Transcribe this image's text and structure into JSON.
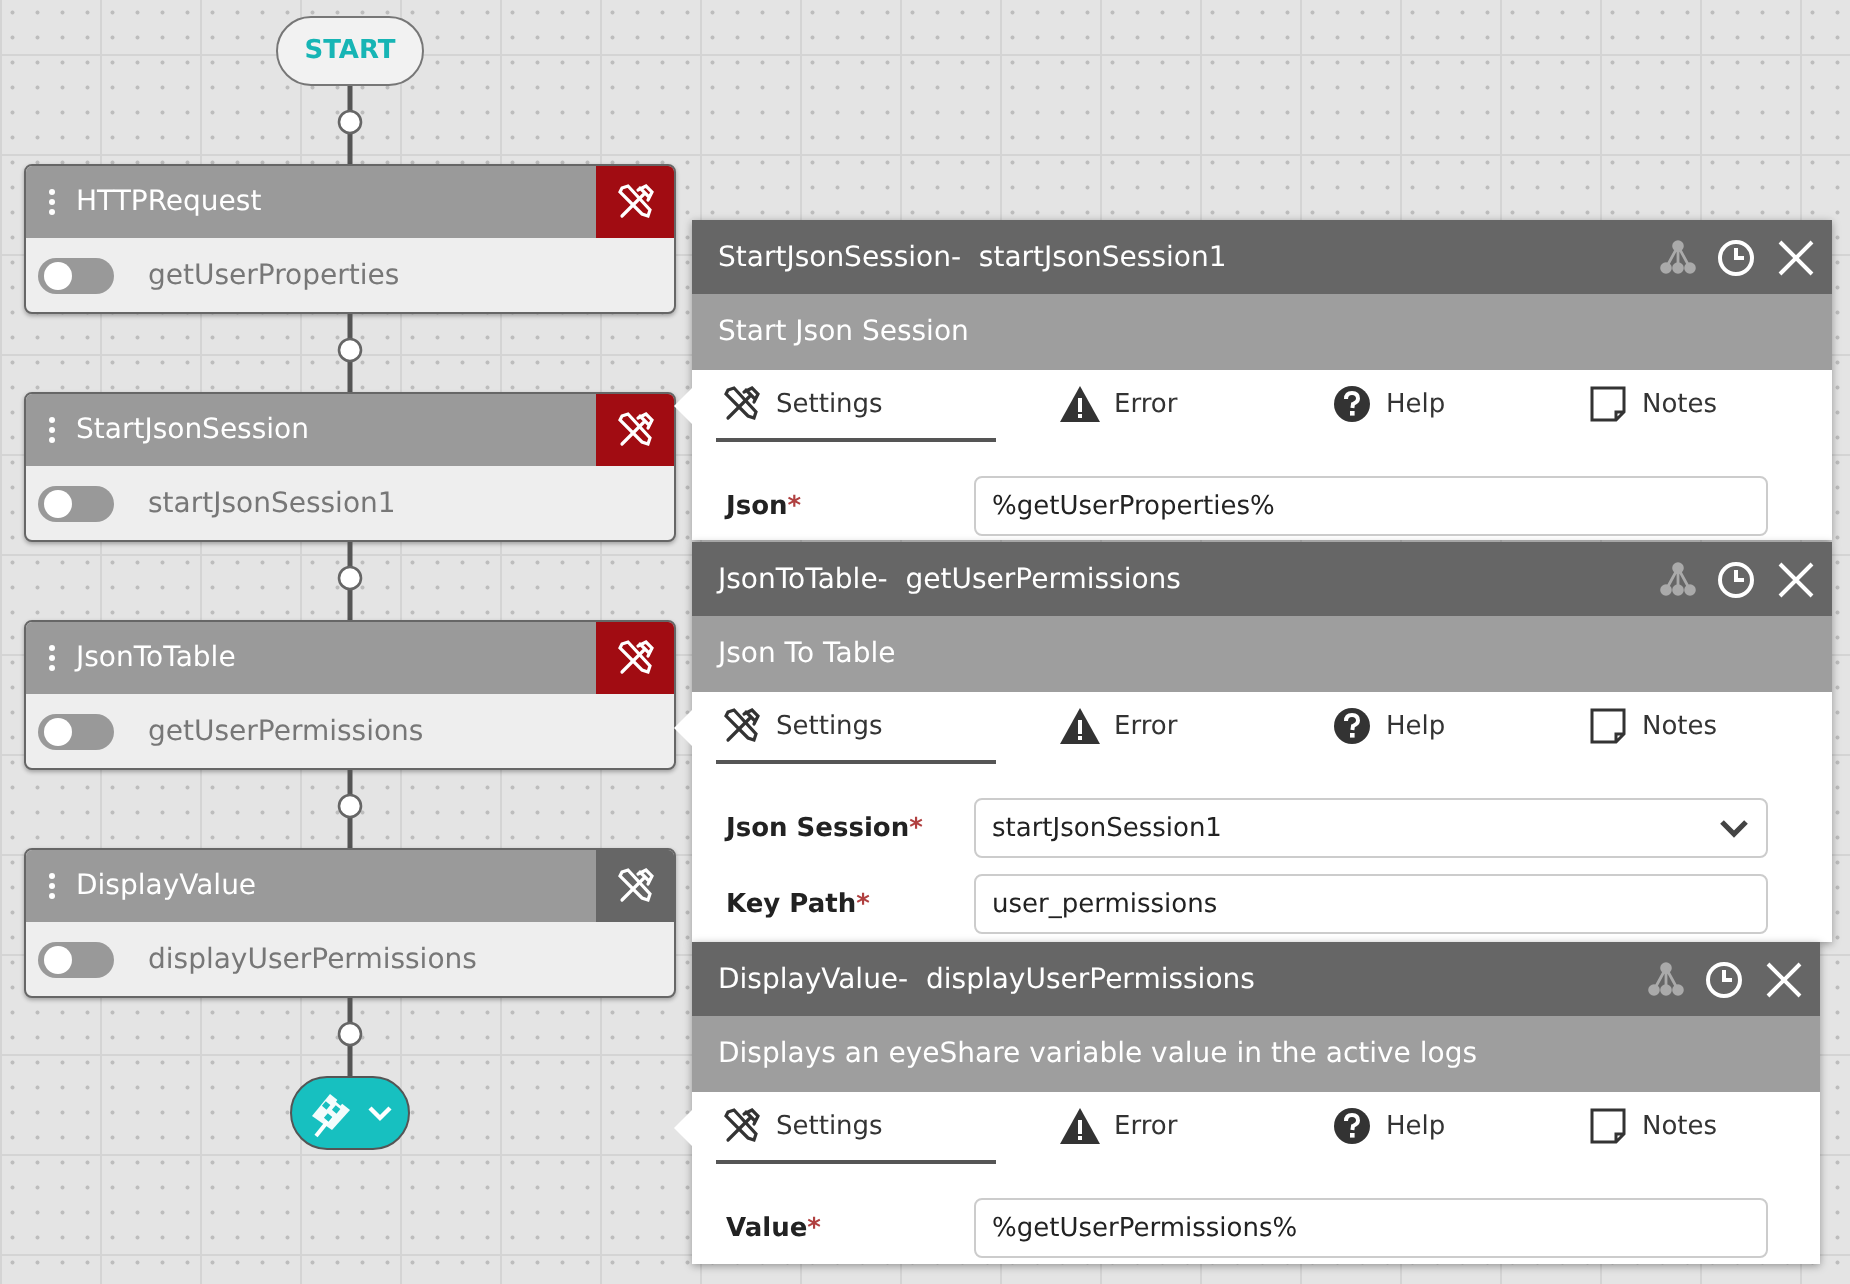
{
  "start": {
    "label": "START"
  },
  "nodes": [
    {
      "type": "HTTPRequest",
      "name": "getUserProperties",
      "on": false,
      "error": true
    },
    {
      "type": "StartJsonSession",
      "name": "startJsonSession1",
      "on": false,
      "error": true
    },
    {
      "type": "JsonToTable",
      "name": "getUserPermissions",
      "on": false,
      "error": true
    },
    {
      "type": "DisplayValue",
      "name": "displayUserPermissions",
      "on": false,
      "error": false
    }
  ],
  "end": {
    "expanded": false
  },
  "panels": [
    {
      "title": "StartJsonSession-  startJsonSession1",
      "subtitle": "Start Json Session",
      "tabs": [
        {
          "label": "Settings",
          "kind": "settings",
          "selected": true
        },
        {
          "label": "Error",
          "kind": "error",
          "selected": false
        },
        {
          "label": "Help",
          "kind": "help",
          "selected": false
        },
        {
          "label": "Notes",
          "kind": "notes",
          "selected": false
        }
      ],
      "fields": [
        {
          "label": "Json",
          "required_mark": "*",
          "kind": "text",
          "value": "%getUserProperties%"
        }
      ]
    },
    {
      "title": "JsonToTable-  getUserPermissions",
      "subtitle": "Json To Table",
      "tabs": [
        {
          "label": "Settings",
          "kind": "settings",
          "selected": true
        },
        {
          "label": "Error",
          "kind": "error",
          "selected": false
        },
        {
          "label": "Help",
          "kind": "help",
          "selected": false
        },
        {
          "label": "Notes",
          "kind": "notes",
          "selected": false
        }
      ],
      "fields": [
        {
          "label": "Json Session",
          "required_mark": "*",
          "kind": "select",
          "value": "startJsonSession1"
        },
        {
          "label": "Key Path",
          "required_mark": "*",
          "kind": "text",
          "value": "user_permissions"
        }
      ]
    },
    {
      "title": "DisplayValue-  displayUserPermissions",
      "subtitle": "Displays an eyeShare variable value in the active logs",
      "tabs": [
        {
          "label": "Settings",
          "kind": "settings",
          "selected": true
        },
        {
          "label": "Error",
          "kind": "error",
          "selected": false
        },
        {
          "label": "Help",
          "kind": "help",
          "selected": false
        },
        {
          "label": "Notes",
          "kind": "notes",
          "selected": false
        }
      ],
      "fields": [
        {
          "label": "Value",
          "required_mark": "*",
          "kind": "text",
          "value": "%getUserPermissions%"
        }
      ]
    }
  ]
}
